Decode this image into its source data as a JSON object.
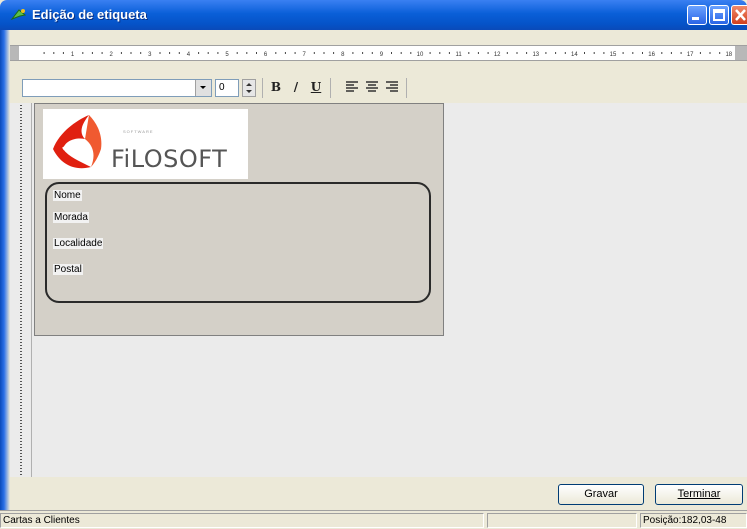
{
  "window": {
    "title": "Edição de etiqueta"
  },
  "toolbar": {
    "font_name": "",
    "font_size": "0",
    "bold_label": "B",
    "italic_label": "/",
    "underline_label": "U",
    "align_left_icon": "align-left-icon",
    "align_center_icon": "align-center-icon",
    "align_right_icon": "align-right-icon"
  },
  "ruler": {
    "numbers": [
      "1",
      "2",
      "3",
      "4",
      "5",
      "6",
      "7",
      "8",
      "9",
      "10",
      "11",
      "12",
      "13",
      "14",
      "15",
      "16",
      "17",
      "18"
    ]
  },
  "label": {
    "logo": {
      "tagline": "SOFTWARE",
      "name": "FiLOSOFT"
    },
    "fields": [
      "Nome",
      "Morada",
      "Localidade",
      "Postal"
    ]
  },
  "buttons": {
    "save": "Gravar",
    "finish": "Terminar"
  },
  "status": {
    "left": "Cartas a Clientes",
    "middle": "",
    "position": "Posição:182,03-48"
  },
  "colors": {
    "titlebar": "#0a5fd8",
    "label_bg": "#d4d0c8",
    "canvas_bg": "#ebebeb",
    "logo_red": "#e02010"
  }
}
